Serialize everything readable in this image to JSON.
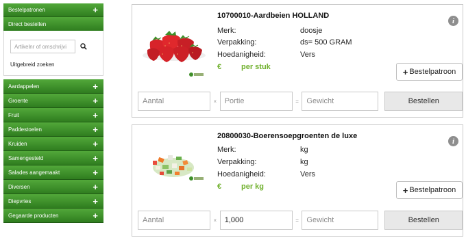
{
  "sidebar": {
    "header_label": "Bestelpatronen",
    "direct_label": "Direct bestellen",
    "search_placeholder": "Artikelnr of omschrijvi",
    "advanced_label": "Uitgebreid zoeken",
    "categories": [
      "Aardappelen",
      "Groente",
      "Fruit",
      "Paddestoelen",
      "Kruiden",
      "Samengesteld",
      "Salades aangemaakt",
      "Diversen",
      "Diepvries",
      "Gegaarde producten"
    ],
    "plus_symbol": "+"
  },
  "labels": {
    "brand": "Merk:",
    "packaging": "Verpakking:",
    "unit_type": "Hoedanigheid:",
    "currency": "€",
    "separator_x": "×",
    "separator_eq": "=",
    "bestelpatroon_button": "Bestelpatroon",
    "order_button": "Bestellen",
    "info": "i"
  },
  "products": [
    {
      "title": "10700010-Aardbeien HOLLAND",
      "brand": "doosje",
      "packaging": "ds= 500 GRAM",
      "unit_type": "Vers",
      "price_unit": "per stuk",
      "qty_placeholder": "Aantal",
      "portion_placeholder": "Portie",
      "portion_value": "",
      "weight_placeholder": "Gewicht",
      "image_icon": "strawberries-photo"
    },
    {
      "title": "20800030-Boerensoepgroenten de luxe",
      "brand": "kg",
      "packaging": "kg",
      "unit_type": "Vers",
      "price_unit": "per kg",
      "qty_placeholder": "Aantal",
      "portion_placeholder": "",
      "portion_value": "1,000",
      "weight_placeholder": "Gewicht",
      "image_icon": "soup-vegetables-photo"
    }
  ]
}
